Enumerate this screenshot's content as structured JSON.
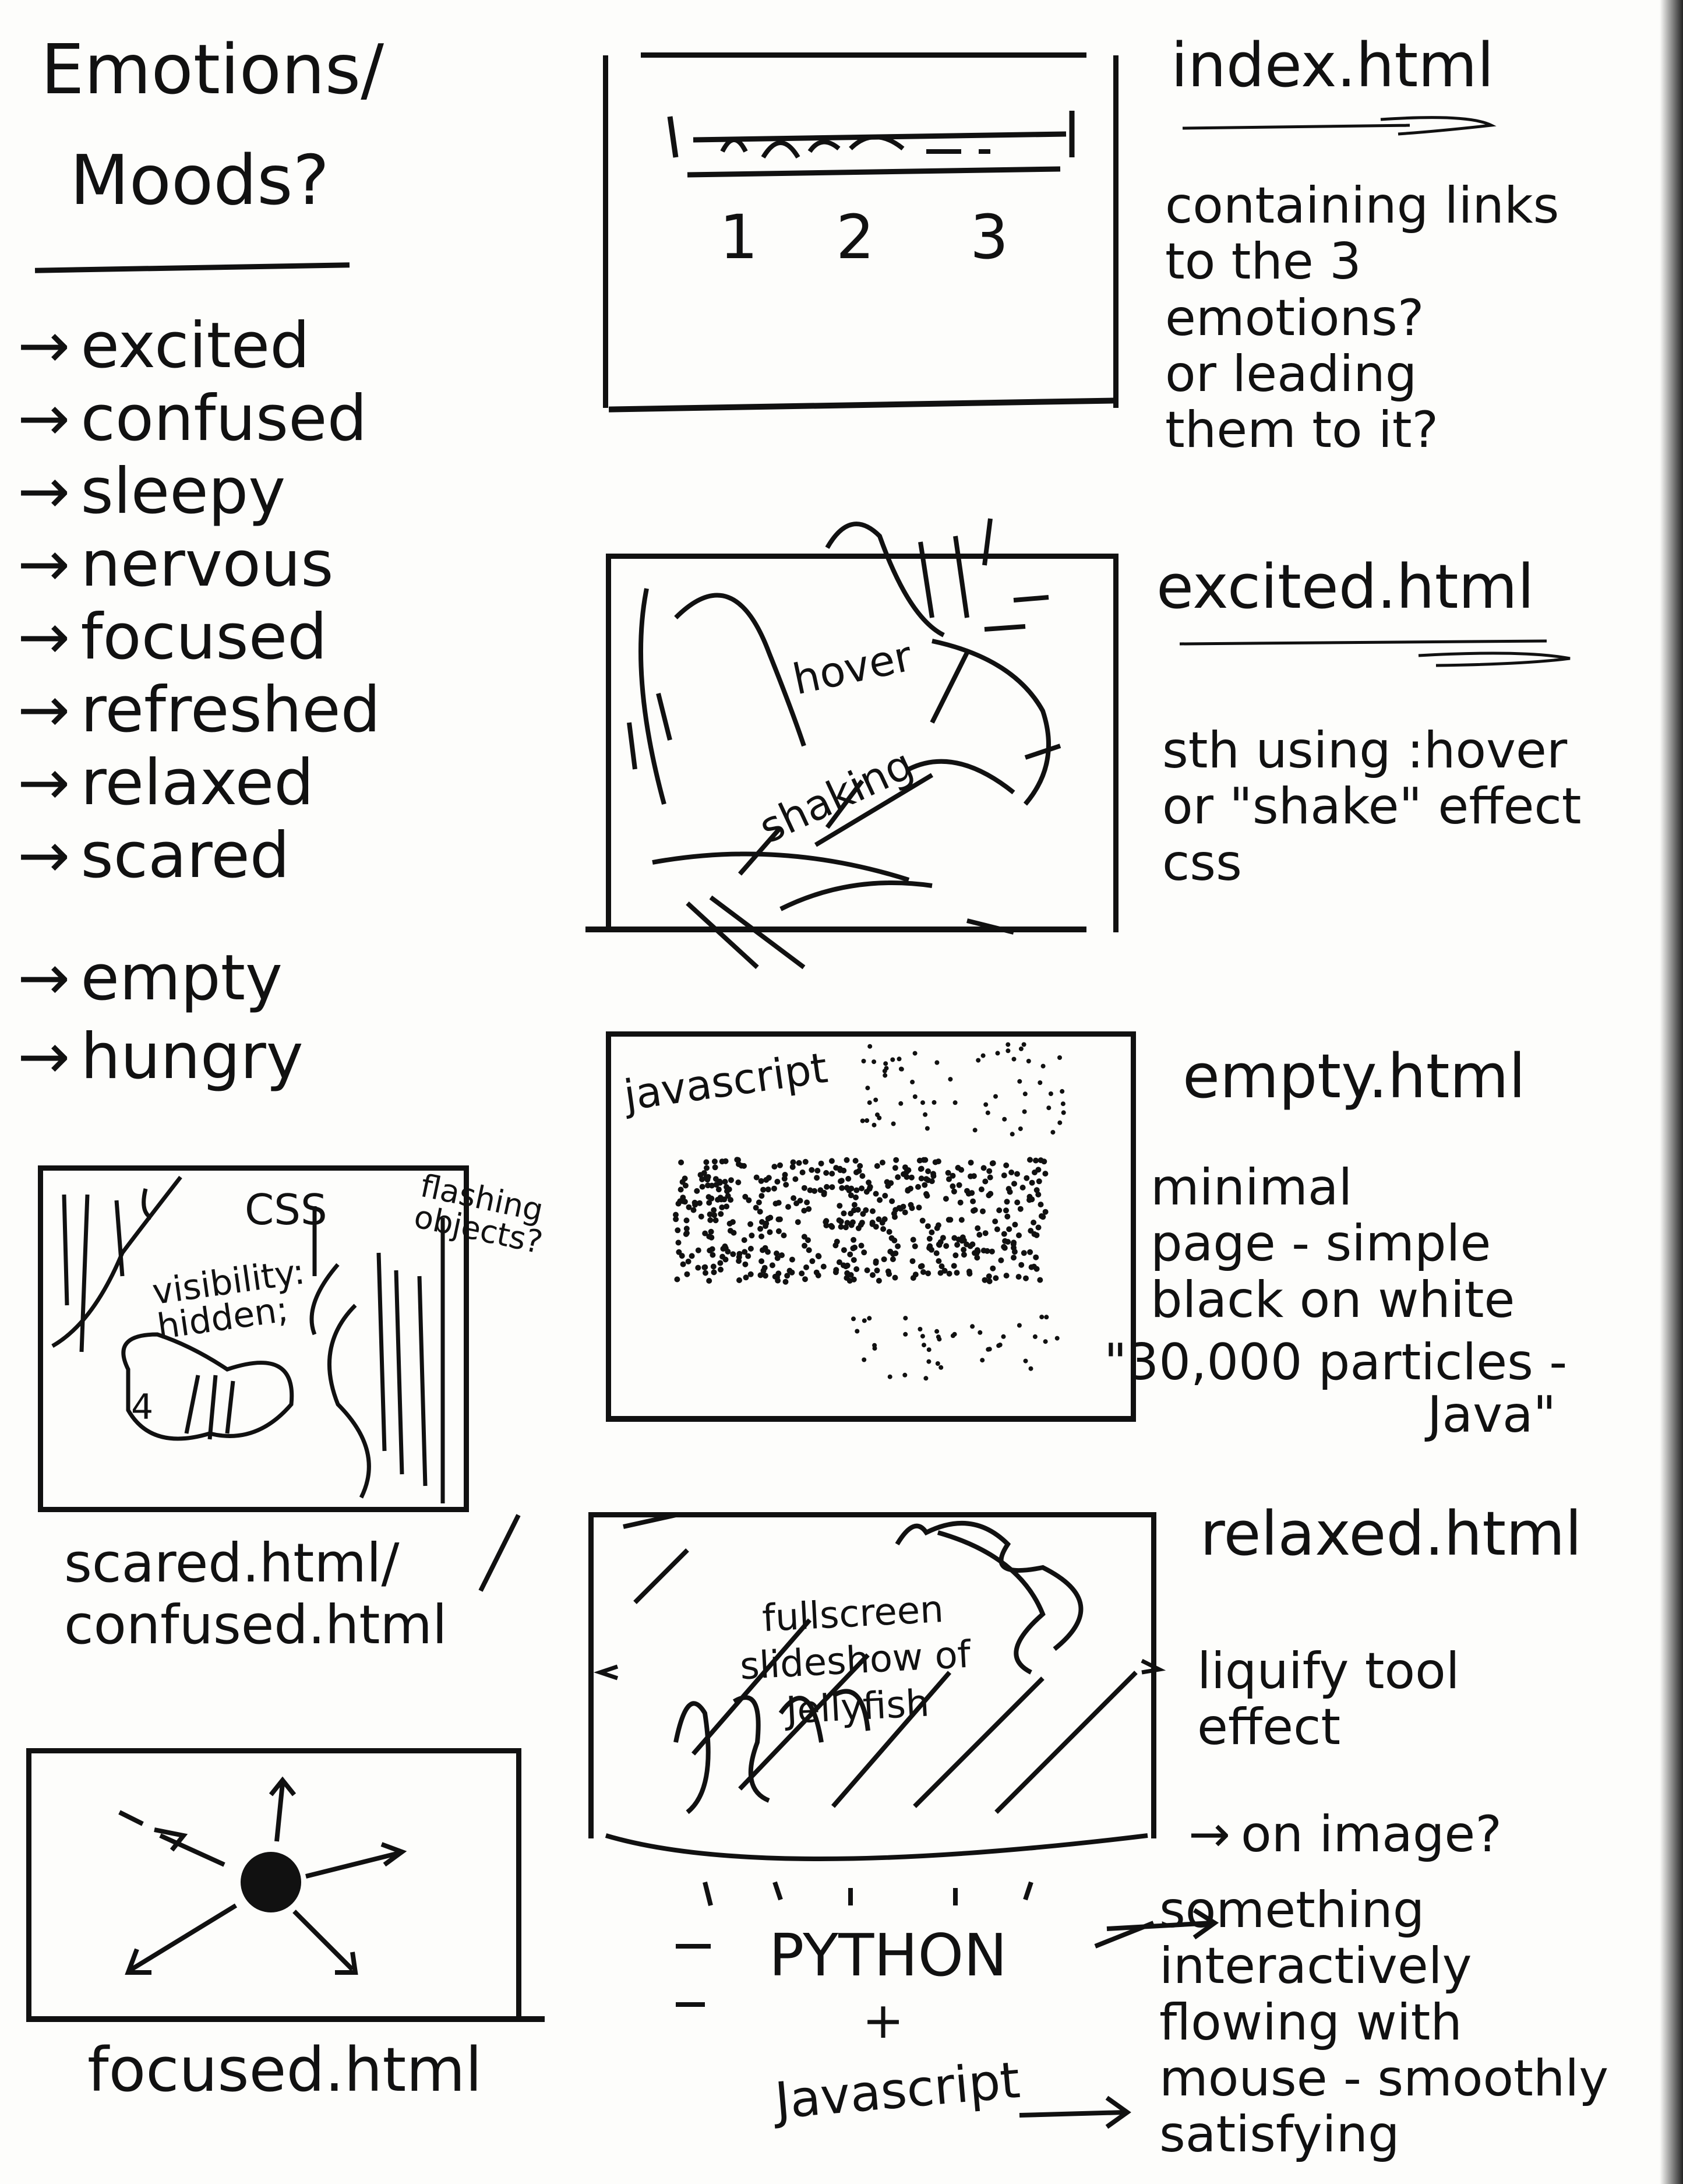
{
  "title": {
    "line1": "Emotions/",
    "line2": "Moods?"
  },
  "moods": [
    {
      "arrow": "→",
      "label": "excited"
    },
    {
      "arrow": "→",
      "label": "confused"
    },
    {
      "arrow": "→",
      "label": "sleepy"
    },
    {
      "arrow": "→",
      "label": "nervous"
    },
    {
      "arrow": "→",
      "label": "focused"
    },
    {
      "arrow": "→",
      "label": "refreshed"
    },
    {
      "arrow": "→",
      "label": "relaxed"
    },
    {
      "arrow": "→",
      "label": "scared"
    },
    {
      "arrow": "→",
      "label": "empty"
    },
    {
      "arrow": "→",
      "label": "hungry"
    }
  ],
  "index": {
    "file": "index.html",
    "numbers": [
      "1",
      "2",
      "3"
    ],
    "note": "containing links\nto the 3\nemotions?\nor leading\nthem to it?"
  },
  "excited": {
    "file": "excited.html",
    "sketch_words": [
      "hover",
      "shaking"
    ],
    "note": "sth using :hover\nor \"shake\" effect\ncss"
  },
  "empty": {
    "file": "empty.html",
    "sketch_label": "javascript",
    "note": "minimal\npage - simple\nblack on white",
    "note2": "\"30,000 particles -",
    "note3": "Java\""
  },
  "scared": {
    "files": "scared.html/\nconfused.html",
    "css_label": "CSS",
    "css_rule": "visibility:\nhidden;",
    "side_note": "flashing\nobjects?",
    "number": "4"
  },
  "relaxed": {
    "file": "relaxed.html",
    "sketch_text": "fullscreen\nslideshow of\nJellyfish",
    "note1": "liquify tool\neffect",
    "arrow": "→",
    "note2": "on image?",
    "tech": "PYTHON",
    "plus": "+",
    "tech2": "Javascript",
    "note3": "something\ninteractively\nflowing with\nmouse - smoothly\nsatisfying"
  },
  "focused": {
    "file": "focused.html"
  }
}
